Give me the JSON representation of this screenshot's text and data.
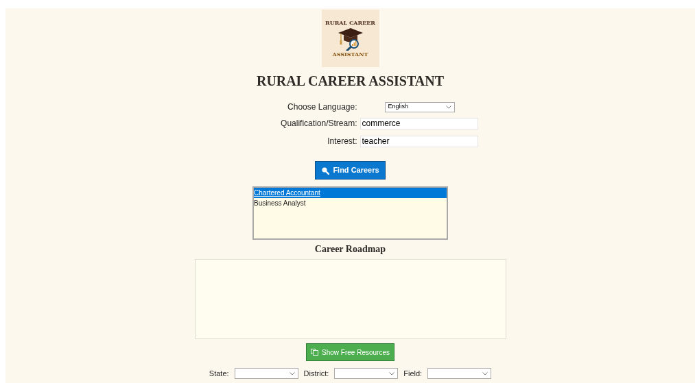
{
  "logo": {
    "top_text": "RURAL CAREER",
    "bottom_text": "ASSISTANT"
  },
  "title": "RURAL CAREER ASSISTANT",
  "form": [
    {
      "kind": "select",
      "label": "Choose Language:",
      "value": "English"
    },
    {
      "kind": "input",
      "label": "Qualification/Stream:",
      "value": "commerce"
    },
    {
      "kind": "input",
      "label": "Interest:",
      "value": "teacher"
    }
  ],
  "find_button": "Find Careers",
  "careers": [
    {
      "label": "Chartered Accountant",
      "selected": true
    },
    {
      "label": "Business Analyst",
      "selected": false
    }
  ],
  "roadmap": {
    "heading": "Career Roadmap"
  },
  "resources_button": "Show Free Resources",
  "filters": [
    {
      "label": "State:"
    },
    {
      "label": "District:"
    },
    {
      "label": "Field:"
    }
  ]
}
